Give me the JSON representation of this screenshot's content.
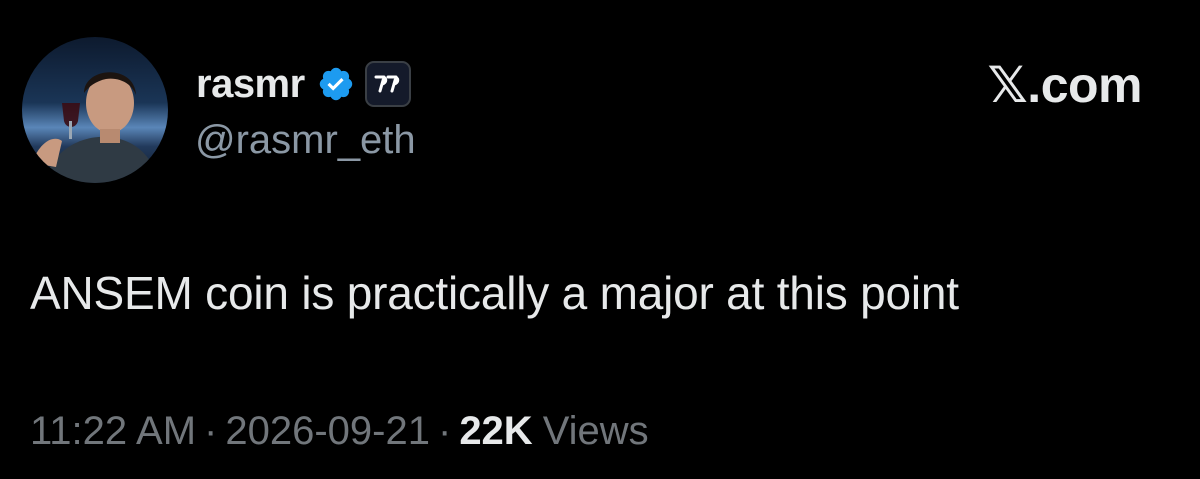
{
  "author": {
    "display_name": "rasmr",
    "handle": "@rasmr_eth",
    "avatar_icon": "profile-photo",
    "verified_icon": "verified-badge-icon",
    "verified_color": "#1d9bf0",
    "affiliate_icon": "affiliate-badge-icon"
  },
  "brand": {
    "label": "𝕏.com"
  },
  "tweet": {
    "text": "ANSEM coin is practically a major at this point"
  },
  "meta": {
    "time": "11:22 AM",
    "separator": "·",
    "date": "2026-09-21",
    "views_count": "22K",
    "views_label": "Views"
  },
  "colors": {
    "background": "#000000",
    "primary_text": "#e7e9ea",
    "secondary_text": "#71767b",
    "handle_text": "#8b98a5"
  }
}
